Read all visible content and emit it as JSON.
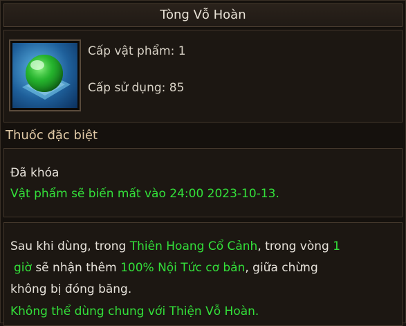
{
  "title": "Tòng Vỗ Hoàn",
  "item": {
    "icon": "green-orb-icon",
    "item_level_label": "Cấp vật phẩm: 1",
    "use_level_label": "Cấp sử dụng: 85"
  },
  "category": "Thuốc đặc biệt",
  "status": {
    "locked": "Đã khóa",
    "expire": "Vật phẩm sẽ biến mất vào 24:00 2023-10-13."
  },
  "description": {
    "l1_a": "Sau khi dùng, trong ",
    "l1_b": "Thiên Hoang Cổ Cảnh",
    "l1_c": ", trong vòng ",
    "l1_d": "1",
    "l2_a": "giờ",
    "l2_b": " sẽ nhận thêm ",
    "l2_c": "100% Nội Tức cơ bản",
    "l2_d": ", giữa chừng",
    "l3": "không bị đóng băng.",
    "l4": "Không thể dùng chung với Thiện Vỗ Hoàn."
  },
  "colors": {
    "highlight_green": "#33e03a",
    "text_white": "#e6e2da",
    "category_tan": "#e0c9a6"
  }
}
